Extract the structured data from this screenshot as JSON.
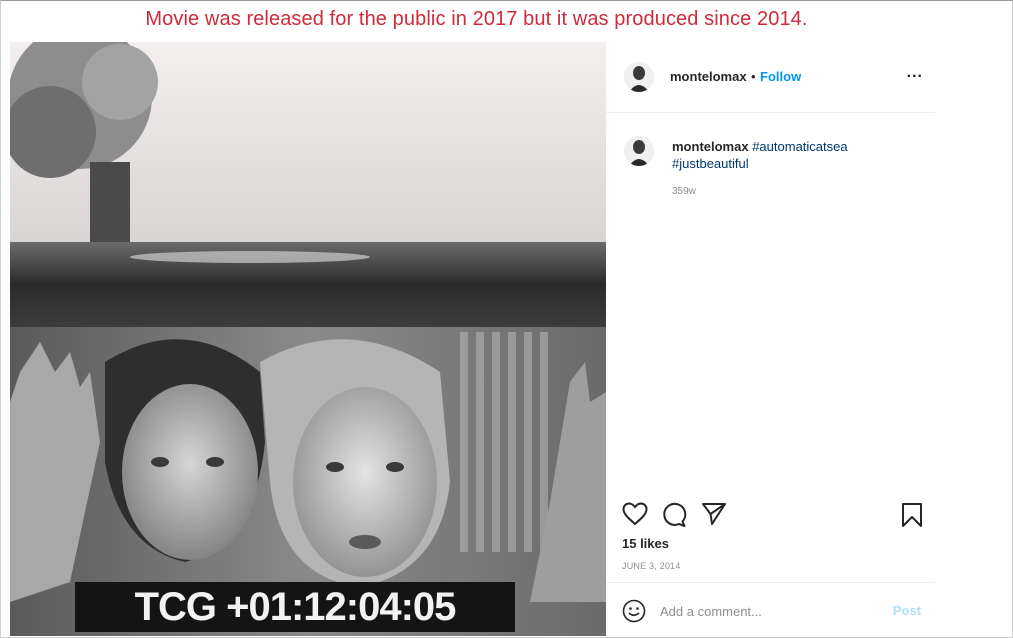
{
  "annotation": {
    "text": "Movie was released for the public in 2017 but it was produced since 2014.",
    "color": "#d12a3a"
  },
  "post": {
    "image_overlay_text": "TCG +01:12:04:05",
    "header": {
      "username": "montelomax",
      "separator": "•",
      "follow_label": "Follow",
      "more_label": "..."
    },
    "caption": {
      "username": "montelomax",
      "hashtags": [
        "#automaticatsea",
        "#justbeautiful"
      ],
      "age": "359w"
    },
    "actions": {
      "like_icon": "heart-icon",
      "comment_icon": "comment-icon",
      "share_icon": "paper-plane-icon",
      "save_icon": "bookmark-icon"
    },
    "likes": "15 likes",
    "date": "JUNE 3, 2014",
    "comment": {
      "emoji_icon": "smiley-icon",
      "placeholder": "Add a comment...",
      "post_label": "Post"
    }
  },
  "colors": {
    "link_blue": "#0095f6",
    "hashtag": "#00376b",
    "muted": "#8e8e8e",
    "post_disabled": "#b2dffc"
  }
}
